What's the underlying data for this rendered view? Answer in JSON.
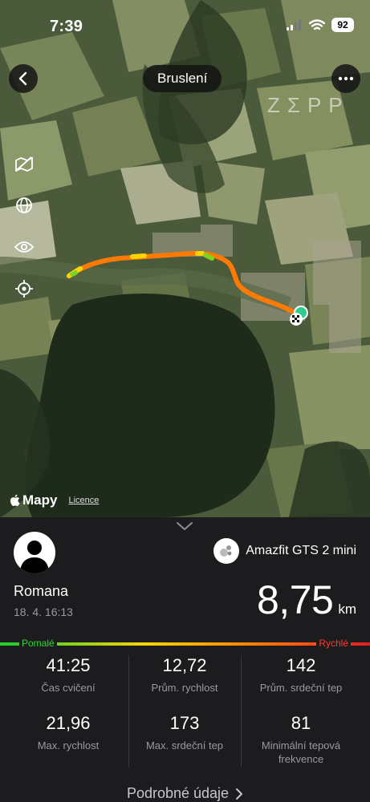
{
  "status_bar": {
    "time": "7:39",
    "battery": "92"
  },
  "header": {
    "title": "Bruslení",
    "brand": "ZΣPP"
  },
  "map": {
    "maps_label": "Mapy",
    "licence_label": "Licence",
    "route_colors": [
      "#ff8a00",
      "#ff6a00",
      "#ffd400",
      "#7ed321",
      "#2ecc2e"
    ]
  },
  "panel": {
    "user": {
      "name": "Romana",
      "date": "18. 4. 16:13"
    },
    "device": {
      "name": "Amazfit GTS 2 mini"
    },
    "distance": {
      "value": "8,75",
      "unit": "km"
    },
    "speed_legend": {
      "slow": "Pomalé",
      "fast": "Rychlé"
    },
    "stats": [
      {
        "value": "41:25",
        "label": "Čas cvičení"
      },
      {
        "value": "12,72",
        "label": "Prům. rychlost"
      },
      {
        "value": "142",
        "label": "Prům. srdeční tep"
      },
      {
        "value": "21,96",
        "label": "Max. rychlost"
      },
      {
        "value": "173",
        "label": "Max. srdeční tep"
      },
      {
        "value": "81",
        "label": "Minimální tepová frekvence"
      }
    ],
    "details_label": "Podrobné údaje"
  }
}
